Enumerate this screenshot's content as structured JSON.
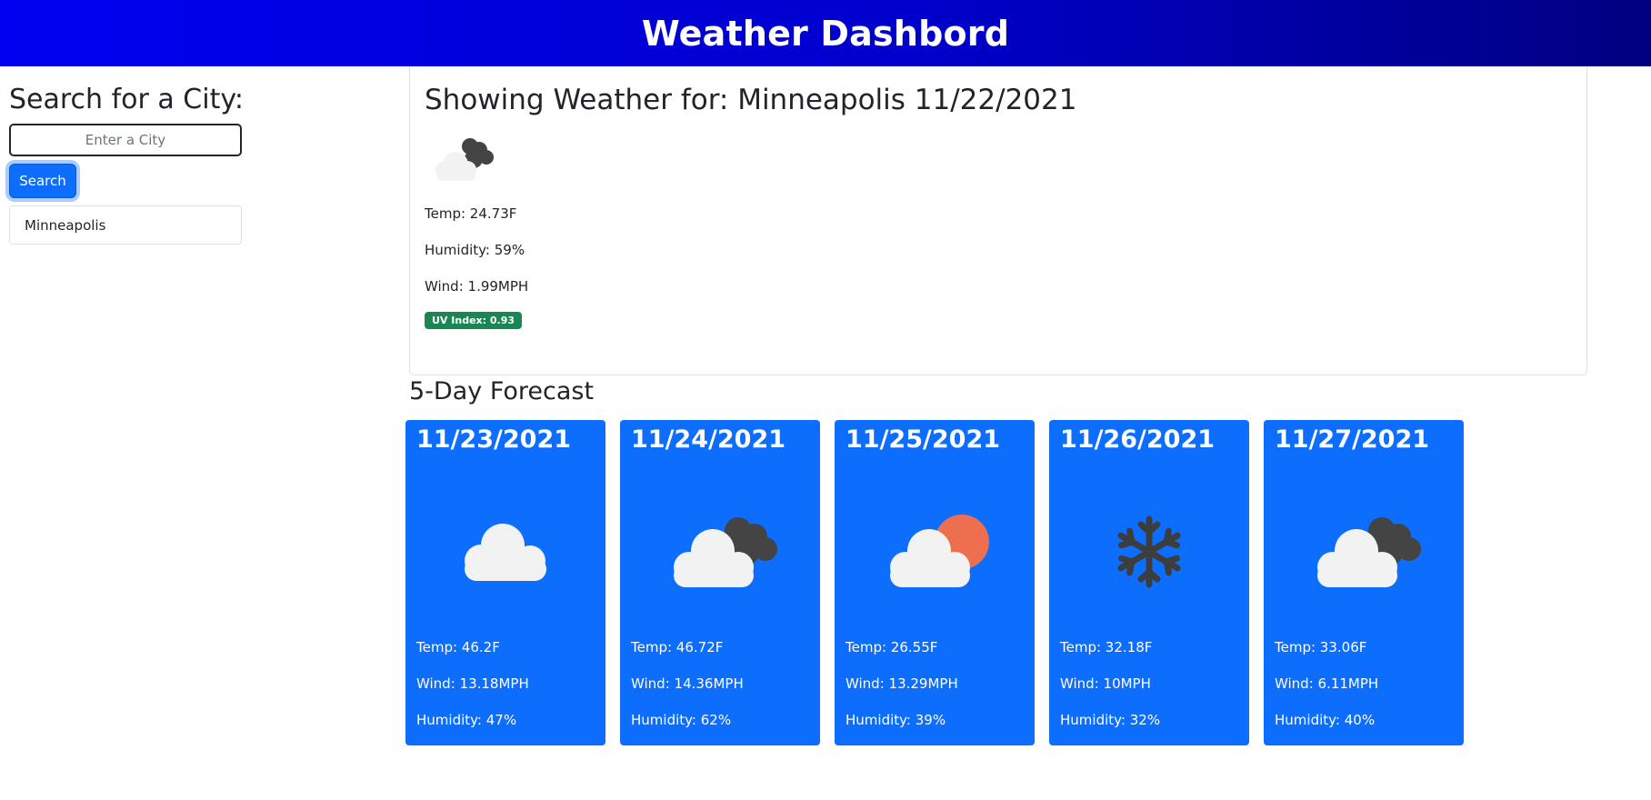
{
  "header": {
    "title": "Weather Dashbord"
  },
  "sidebar": {
    "heading": "Search for a City:",
    "input_placeholder": "Enter a City",
    "input_value": "",
    "search_label": "Search",
    "history": [
      "Minneapolis"
    ]
  },
  "current": {
    "title": "Showing Weather for: Minneapolis 11/22/2021",
    "icon": "broken-clouds-icon",
    "temp": "Temp: 24.73F",
    "humidity": "Humidity: 59%",
    "wind": "Wind: 1.99MPH",
    "uv": "UV Index: 0.93",
    "uv_color": "#198754"
  },
  "forecast": {
    "title": "5-Day Forecast",
    "card_color": "#0d6efd",
    "days": [
      {
        "date": "11/23/2021",
        "icon": "cloud-icon",
        "temp": "Temp: 46.2F",
        "wind": "Wind: 13.18MPH",
        "humidity": "Humidity: 47%"
      },
      {
        "date": "11/24/2021",
        "icon": "broken-clouds-icon",
        "temp": "Temp: 46.72F",
        "wind": "Wind: 14.36MPH",
        "humidity": "Humidity: 62%"
      },
      {
        "date": "11/25/2021",
        "icon": "partly-sunny-icon",
        "temp": "Temp: 26.55F",
        "wind": "Wind: 13.29MPH",
        "humidity": "Humidity: 39%"
      },
      {
        "date": "11/26/2021",
        "icon": "snowflake-icon",
        "temp": "Temp: 32.18F",
        "wind": "Wind: 10MPH",
        "humidity": "Humidity: 32%"
      },
      {
        "date": "11/27/2021",
        "icon": "broken-clouds-icon",
        "temp": "Temp: 33.06F",
        "wind": "Wind: 6.11MPH",
        "humidity": "Humidity: 40%"
      }
    ]
  }
}
